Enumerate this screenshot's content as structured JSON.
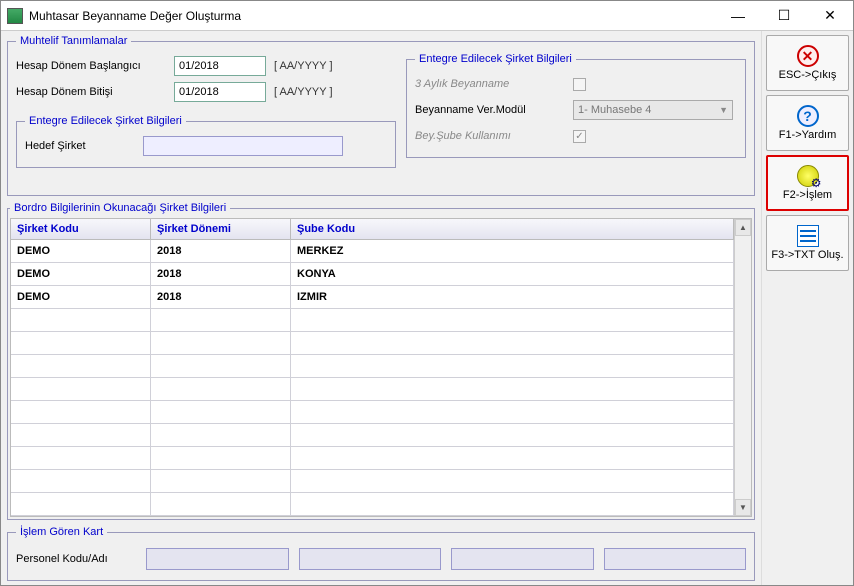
{
  "window": {
    "title": "Muhtasar Beyanname Değer Oluşturma"
  },
  "sidebar": {
    "esc": "ESC->Çıkış",
    "f1": "F1->Yardım",
    "f2": "F2->İşlem",
    "f3": "F3->TXT Oluş."
  },
  "muhtelif": {
    "legend": "Muhtelif Tanımlamalar",
    "start_label": "Hesap Dönem Başlangıcı",
    "start_value": "01/2018",
    "start_fmt": "[ AA/YYYY ]",
    "end_label": "Hesap Dönem Bitişi",
    "end_value": "01/2018",
    "end_fmt": "[ AA/YYYY ]",
    "entegre_inner_legend": "Entegre Edilecek Şirket Bilgileri",
    "hedef_label": "Hedef Şirket",
    "hedef_value": ""
  },
  "entegre": {
    "legend": "Entegre Edilecek Şirket Bilgileri",
    "uc_aylik": "3 Aylık Beyanname",
    "modul_label": "Beyanname Ver.Modül",
    "modul_value": "1-  Muhasebe 4",
    "sube_label": "Bey.Şube Kullanımı",
    "sube_checked": "✓"
  },
  "bordro": {
    "legend": "Bordro Bilgilerinin Okunacağı Şirket Bilgileri",
    "headers": {
      "kod": "Şirket Kodu",
      "donem": "Şirket Dönemi",
      "sube": "Şube Kodu"
    },
    "rows": [
      {
        "kod": "DEMO",
        "donem": "2018",
        "sube": "MERKEZ"
      },
      {
        "kod": "DEMO",
        "donem": "2018",
        "sube": "KONYA"
      },
      {
        "kod": "DEMO",
        "donem": "2018",
        "sube": "IZMIR"
      }
    ]
  },
  "islem": {
    "legend": "İşlem Gören Kart",
    "label": "Personel Kodu/Adı"
  }
}
